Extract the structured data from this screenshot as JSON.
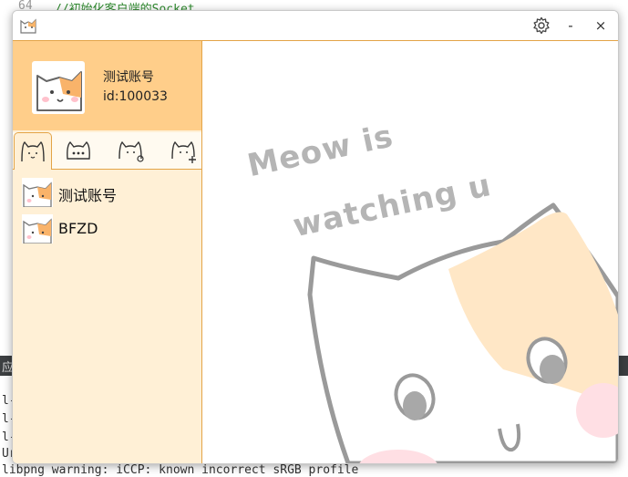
{
  "ide": {
    "line_number": "64",
    "top_comment": "//初始化客户端的Socket",
    "bottom_line_1": "l-",
    "bottom_line_2": "l-",
    "bottom_line_3": "l-",
    "bottom_line_4": "Ur",
    "bottom_warning": "libpng warning: iCCP: known incorrect sRGB profile",
    "panel_glyph": "应"
  },
  "titlebar": {
    "settings_icon": "gear-icon",
    "minimize_label": "-",
    "close_label": "×"
  },
  "profile": {
    "username": "测试账号",
    "user_id": "id:100033"
  },
  "tabs": [
    {
      "icon": "cat-face-icon",
      "active": true
    },
    {
      "icon": "cat-chat-icon",
      "active": false
    },
    {
      "icon": "cat-group-icon",
      "active": false
    },
    {
      "icon": "cat-add-icon",
      "active": false
    }
  ],
  "contacts": [
    {
      "name": "测试账号"
    },
    {
      "name": "BFZD"
    }
  ],
  "watermark": {
    "line1": "Meow is",
    "line2": "watching u"
  },
  "colors": {
    "accent": "#e3a447",
    "profile_bg": "#ffce8a",
    "sidebar_bg": "#fff0d6"
  }
}
